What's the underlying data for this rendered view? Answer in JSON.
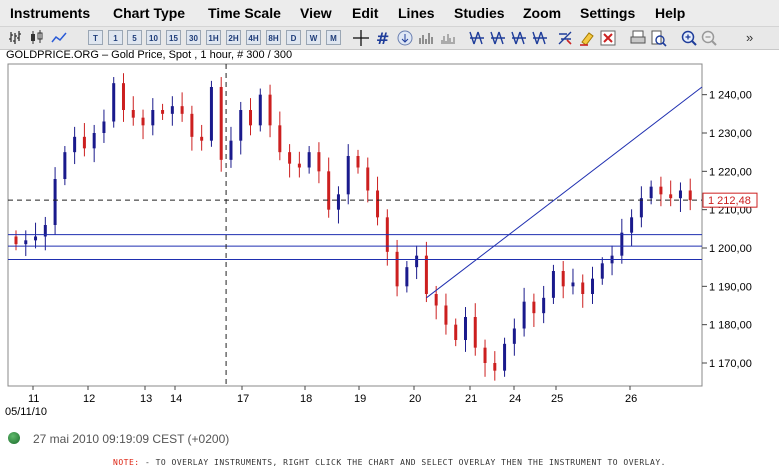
{
  "menu": [
    "Instruments",
    "Chart Type",
    "Time Scale",
    "View",
    "Edit",
    "Lines",
    "Studies",
    "Zoom",
    "Settings",
    "Help"
  ],
  "toolbar": {
    "timeframes": [
      "T",
      "1",
      "5",
      "10",
      "15",
      "30",
      "1H",
      "2H",
      "4H",
      "8H",
      "D",
      "W",
      "M"
    ],
    "collapse_glyph": "»"
  },
  "chart": {
    "title": "GOLDPRICE.ORG – Gold Price, Spot , 1 hour, # 300 / 300",
    "current_price": "1 212,48",
    "start_date": "05/11/10",
    "colors": {
      "up": "#1a1a8c",
      "down": "#cc1f1f",
      "line": "#1f2fb0",
      "price_tag": "#cc1f1f"
    }
  },
  "chart_data": {
    "type": "candlestick",
    "x_labels": [
      "11",
      "12",
      "13",
      "14",
      "17",
      "18",
      "19",
      "20",
      "21",
      "24",
      "25",
      "26"
    ],
    "y_ticks": [
      "1 170,00",
      "1 180,00",
      "1 190,00",
      "1 200,00",
      "1 210,00",
      "1 220,00",
      "1 230,00",
      "1 240,00"
    ],
    "ylim": [
      1164,
      1248
    ],
    "horizontal_lines": [
      1203.5,
      1200.5,
      1197
    ],
    "dashed_price_line": 1212.48,
    "trendline": [
      [
        42,
        1187
      ],
      [
        66,
        1242
      ]
    ],
    "crosshair_x": 21.5,
    "n_bars": 70,
    "closes": [
      1201,
      1202,
      1203,
      1206,
      1218,
      1225,
      1229,
      1226,
      1230,
      1233,
      1243,
      1236,
      1234,
      1232,
      1236,
      1235,
      1237,
      1235,
      1229,
      1228,
      1242,
      1223,
      1228,
      1236,
      1232,
      1240,
      1232,
      1225,
      1222,
      1221,
      1225,
      1220,
      1210,
      1214,
      1224,
      1221,
      1215,
      1208,
      1199,
      1190,
      1195,
      1198,
      1188,
      1185,
      1180,
      1176,
      1182,
      1174,
      1170,
      1168,
      1175,
      1179,
      1186,
      1183,
      1187,
      1194,
      1190,
      1191,
      1188,
      1192,
      1196,
      1198,
      1204,
      1208,
      1213,
      1216,
      1214,
      1213,
      1215,
      1212.48
    ],
    "open": 1203,
    "last": "1 212,48"
  },
  "status": {
    "datetime": "27 mai 2010 09:19:09  CEST (+0200)"
  },
  "footer": {
    "note_label": "NOTE:",
    "note_text": " - TO OVERLAY INSTRUMENTS, RIGHT CLICK THE CHART AND SELECT OVERLAY THEN THE INSTRUMENT TO OVERLAY."
  }
}
